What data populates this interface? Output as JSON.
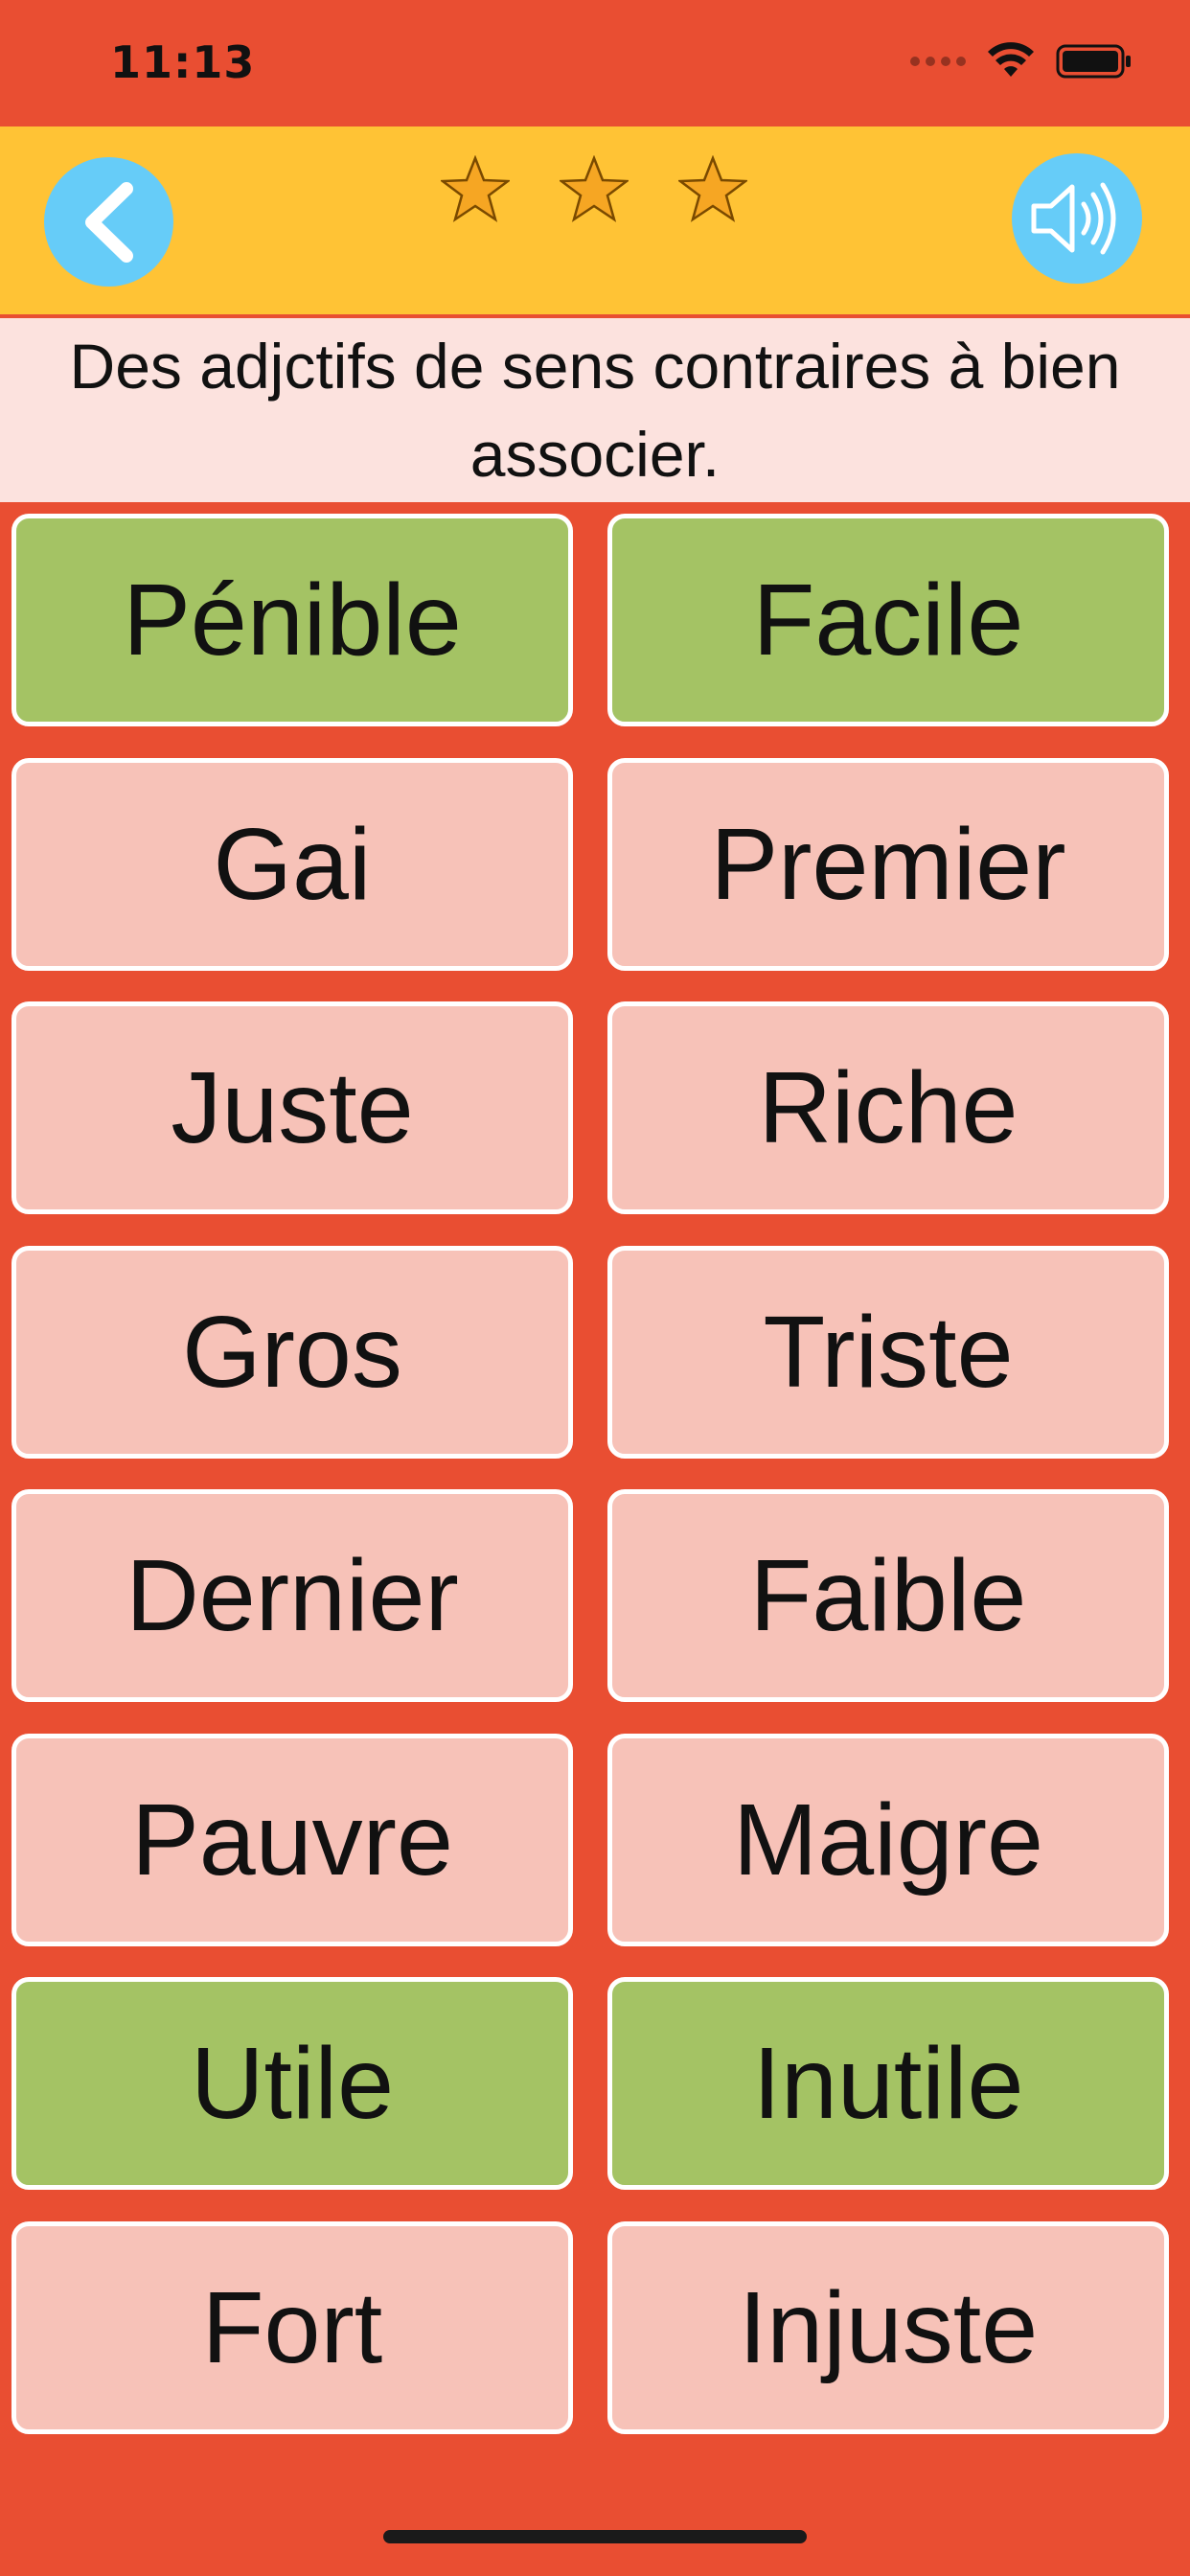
{
  "status_bar": {
    "time": "11:13",
    "icons": [
      "signal-dots-icon",
      "wifi-icon",
      "battery-icon"
    ]
  },
  "header": {
    "back_icon": "chevron-left-icon",
    "sound_icon": "speaker-icon",
    "stars": 3
  },
  "instruction": "Des adjctifs de sens contraires à bien associer.",
  "colors": {
    "background": "#E94E32",
    "header": "#FFC335",
    "button": "#66CCF8",
    "card_default": "#F7C2B8",
    "card_matched": "#A4C364"
  },
  "cards": [
    {
      "label": "Pénible",
      "matched": true
    },
    {
      "label": "Facile",
      "matched": true
    },
    {
      "label": "Gai",
      "matched": false
    },
    {
      "label": "Premier",
      "matched": false
    },
    {
      "label": "Juste",
      "matched": false
    },
    {
      "label": "Riche",
      "matched": false
    },
    {
      "label": "Gros",
      "matched": false
    },
    {
      "label": "Triste",
      "matched": false
    },
    {
      "label": "Dernier",
      "matched": false
    },
    {
      "label": "Faible",
      "matched": false
    },
    {
      "label": "Pauvre",
      "matched": false
    },
    {
      "label": "Maigre",
      "matched": false
    },
    {
      "label": "Utile",
      "matched": true
    },
    {
      "label": "Inutile",
      "matched": true
    },
    {
      "label": "Fort",
      "matched": false
    },
    {
      "label": "Injuste",
      "matched": false
    }
  ]
}
